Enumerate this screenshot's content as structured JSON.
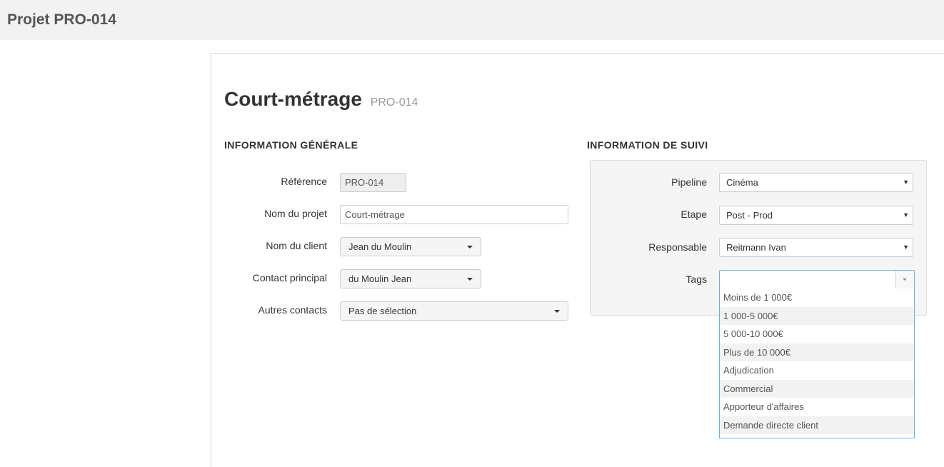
{
  "page": {
    "title": "Projet PRO-014"
  },
  "project": {
    "name": "Court-métrage",
    "code": "PRO-014"
  },
  "general": {
    "section_title": "INFORMATION GÉNÉRALE",
    "reference_label": "Référence",
    "reference_value": "PRO-014",
    "project_name_label": "Nom du projet",
    "project_name_value": "Court-métrage",
    "client_label": "Nom du client",
    "client_value": "Jean du Moulin",
    "main_contact_label": "Contact principal",
    "main_contact_value": "du Moulin Jean",
    "other_contacts_label": "Autres contacts",
    "other_contacts_value": "Pas de sélection"
  },
  "tracking": {
    "section_title": "INFORMATION DE SUIVI",
    "pipeline_label": "Pipeline",
    "pipeline_value": "Cinéma",
    "stage_label": "Etape",
    "stage_value": "Post - Prod",
    "owner_label": "Responsable",
    "owner_value": "Reitmann Ivan",
    "tags_label": "Tags",
    "tags_value": "",
    "tag_options": [
      "Moins de 1 000€",
      "1 000-5 000€",
      "5 000-10 000€",
      "Plus de 10 000€",
      "Adjudication",
      "Commercial",
      "Apporteur d'affaires",
      "Demande directe client"
    ]
  },
  "colors": {
    "topbar": "#f2f2f2",
    "panel": "#f5f5f5",
    "focus_border": "#66afe9"
  }
}
